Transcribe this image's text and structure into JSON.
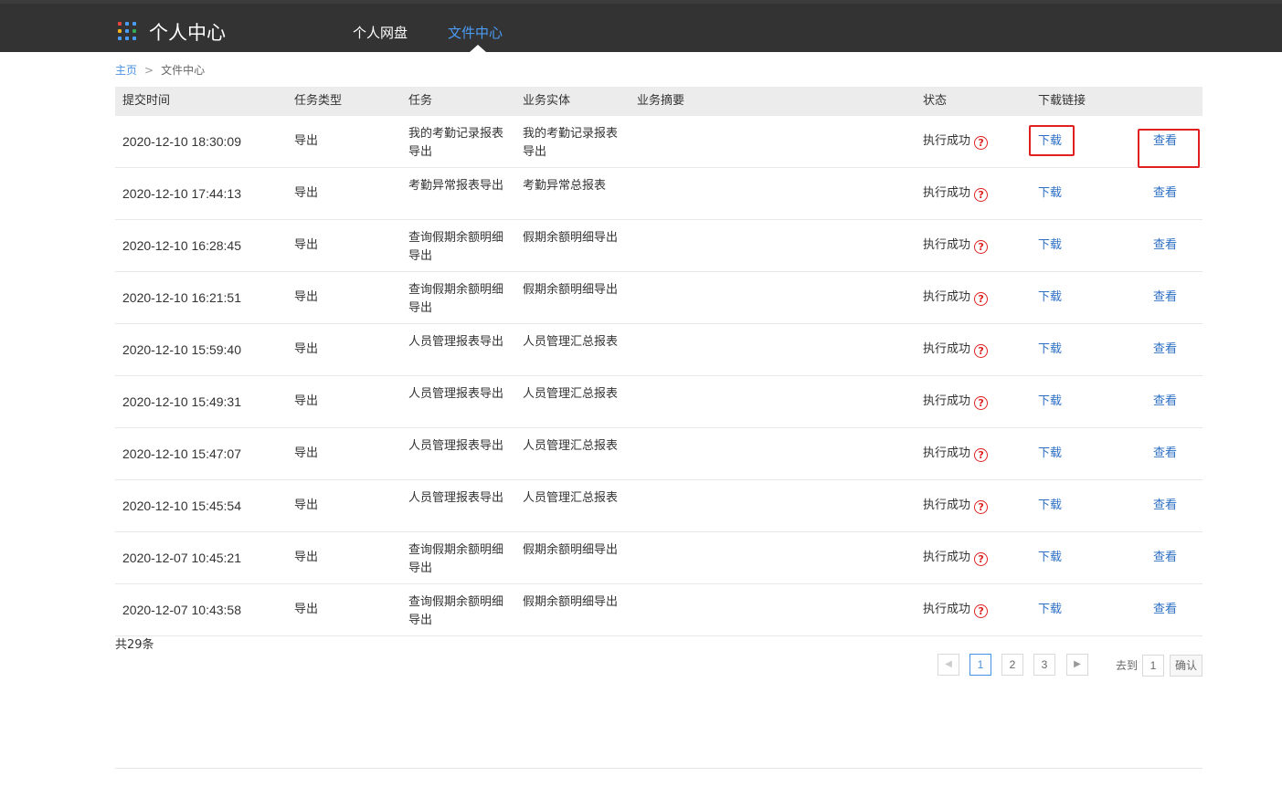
{
  "header": {
    "brand": "个人中心",
    "nav": [
      {
        "label": "个人网盘",
        "active": false
      },
      {
        "label": "文件中心",
        "active": true
      }
    ],
    "accent_color": "#4a9cf5",
    "bar_color": "#333333",
    "logo_icon": "app-grid-icon"
  },
  "breadcrumb": {
    "home": "主页",
    "separator": ">",
    "current": "文件中心"
  },
  "table": {
    "columns": [
      "提交时间",
      "任务类型",
      "任务",
      "业务实体",
      "业务摘要",
      "状态",
      "下载链接",
      ""
    ],
    "rows": [
      {
        "time": "2020-12-10 18:30:09",
        "type": "导出",
        "task": "我的考勤记录报表导出",
        "entity": "我的考勤记录报表导出",
        "summary": "",
        "status": "执行成功",
        "download": "下载",
        "view": "查看"
      },
      {
        "time": "2020-12-10 17:44:13",
        "type": "导出",
        "task": "考勤异常报表导出",
        "entity": "考勤异常总报表",
        "summary": "",
        "status": "执行成功",
        "download": "下载",
        "view": "查看"
      },
      {
        "time": "2020-12-10 16:28:45",
        "type": "导出",
        "task": "查询假期余额明细导出",
        "entity": "假期余额明细导出",
        "summary": "",
        "status": "执行成功",
        "download": "下载",
        "view": "查看"
      },
      {
        "time": "2020-12-10 16:21:51",
        "type": "导出",
        "task": "查询假期余额明细导出",
        "entity": "假期余额明细导出",
        "summary": "",
        "status": "执行成功",
        "download": "下载",
        "view": "查看"
      },
      {
        "time": "2020-12-10 15:59:40",
        "type": "导出",
        "task": "人员管理报表导出",
        "entity": "人员管理汇总报表",
        "summary": "",
        "status": "执行成功",
        "download": "下载",
        "view": "查看"
      },
      {
        "time": "2020-12-10 15:49:31",
        "type": "导出",
        "task": "人员管理报表导出",
        "entity": "人员管理汇总报表",
        "summary": "",
        "status": "执行成功",
        "download": "下载",
        "view": "查看"
      },
      {
        "time": "2020-12-10 15:47:07",
        "type": "导出",
        "task": "人员管理报表导出",
        "entity": "人员管理汇总报表",
        "summary": "",
        "status": "执行成功",
        "download": "下载",
        "view": "查看"
      },
      {
        "time": "2020-12-10 15:45:54",
        "type": "导出",
        "task": "人员管理报表导出",
        "entity": "人员管理汇总报表",
        "summary": "",
        "status": "执行成功",
        "download": "下载",
        "view": "查看"
      },
      {
        "time": "2020-12-07 10:45:21",
        "type": "导出",
        "task": "查询假期余额明细导出",
        "entity": "假期余额明细导出",
        "summary": "",
        "status": "执行成功",
        "download": "下载",
        "view": "查看"
      },
      {
        "time": "2020-12-07 10:43:58",
        "type": "导出",
        "task": "查询假期余额明细导出",
        "entity": "假期余额明细导出",
        "summary": "",
        "status": "执行成功",
        "download": "下载",
        "view": "查看"
      }
    ],
    "status_help_icon": "question-circle-icon",
    "status_help_glyph": "?",
    "highlight_color": "#e02020",
    "link_color": "#2d6fc4"
  },
  "footer": {
    "total": "共29条",
    "pages": [
      "1",
      "2",
      "3"
    ],
    "current_page": "1",
    "prev_icon": "prev-arrow-icon",
    "next_icon": "next-arrow-icon",
    "prev_glyph": "◀",
    "next_glyph": "▶",
    "goto_label": "去到",
    "goto_value": "1",
    "confirm_label": "确认"
  }
}
